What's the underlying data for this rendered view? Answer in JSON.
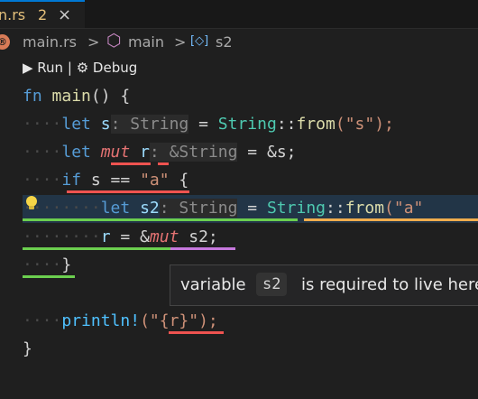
{
  "tab": {
    "name": "n.rs",
    "problem_count": "2",
    "close": "×"
  },
  "breadcrumbs": {
    "icon_text": "®",
    "file": "main.rs",
    "symbol_1": "main",
    "symbol_2": "s2",
    "separator": ">"
  },
  "codelens": {
    "run": "▶ Run",
    "separator": "|",
    "debug": "⚙ Debug"
  },
  "code": {
    "line1": {
      "kw": "fn",
      "name": "main",
      "rest": "() {"
    },
    "line2": {
      "ws": "····",
      "kw": "let",
      "var": "s",
      "hint": ": String",
      "rest1": " = ",
      "type": "String",
      "rest2": "::",
      "fn": "from",
      "str": "(\"s\");"
    },
    "line3": {
      "ws": "····",
      "kw": "let",
      "kw2": "mut",
      "var": "r",
      "hint": ": &String",
      "rest": " = &s;"
    },
    "line4": {
      "ws": "····",
      "kw": "if",
      "rest1": " s == ",
      "str": "\"a\"",
      "rest2": " {"
    },
    "line5": {
      "ws": "········",
      "kw": "let",
      "var": "s2",
      "hint": ": String",
      "rest1": " = ",
      "type": "String",
      "rest2": "::",
      "fn": "from",
      "str": "(\"a\""
    },
    "line6": {
      "ws": "········",
      "var": "r",
      "rest1": " = &",
      "kw": "mut",
      "rest2": " s2;"
    },
    "line7": {
      "ws": "····",
      "rest": "}"
    },
    "line8": {
      "ws": "····",
      "mac": "println!",
      "str": "(\"{r}\");"
    },
    "line9": {
      "rest": "}"
    }
  },
  "tooltip": {
    "prefix": "variable",
    "code": "s2",
    "suffix": "is required to live here"
  }
}
